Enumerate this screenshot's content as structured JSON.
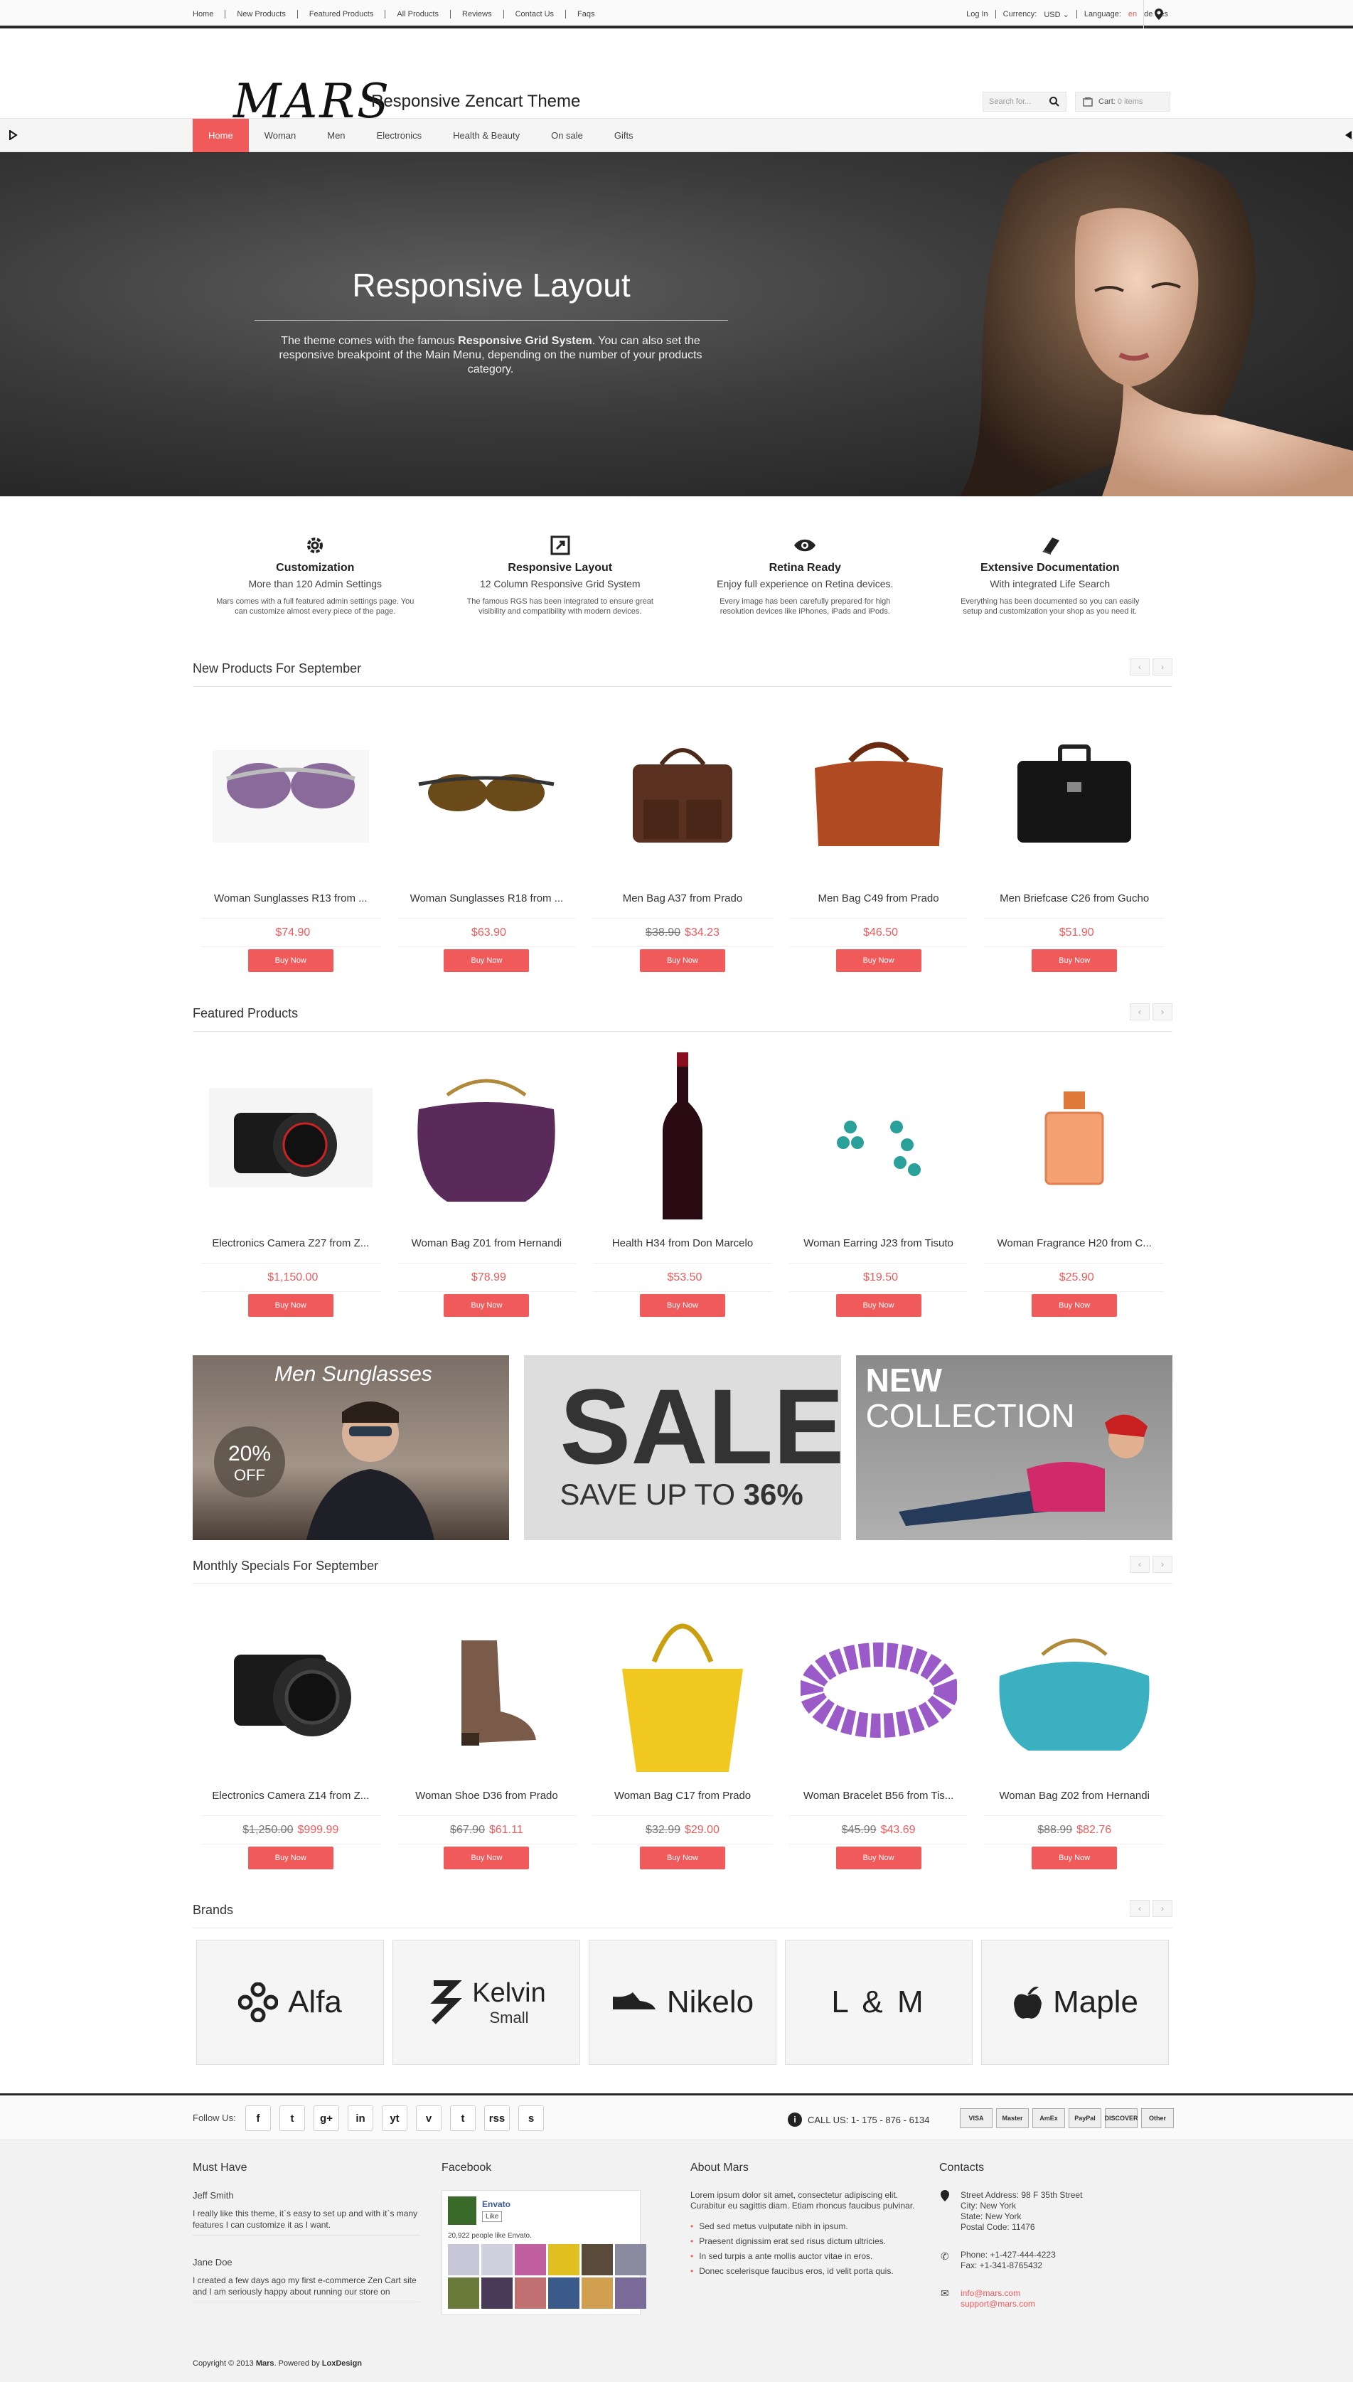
{
  "topbar": {
    "links": [
      "Home",
      "New Products",
      "Featured Products",
      "All Products",
      "Reviews",
      "Contact Us",
      "Faqs"
    ],
    "login": "Log In",
    "currency_label": "Currency:",
    "currency_value": "USD",
    "language_label": "Language:",
    "lang_en": "en",
    "lang_de": "de",
    "lang_es": "es"
  },
  "header": {
    "logo": "MARS",
    "tagline": "Responsive Zencart Theme",
    "search_placeholder": "Search for...",
    "cart_label": "Cart:",
    "cart_items": "0 items"
  },
  "nav": {
    "items": [
      "Home",
      "Woman",
      "Men",
      "Electronics",
      "Health & Beauty",
      "On sale",
      "Gifts"
    ]
  },
  "hero": {
    "title": "Responsive Layout",
    "text_before": "The theme comes with the famous ",
    "text_bold": "Responsive Grid System",
    "text_after": ". You can also set the responsive breakpoint of the Main Menu, depending on the number of your products category."
  },
  "features": [
    {
      "title": "Customization",
      "subtitle": "More than 120 Admin Settings",
      "text": "Mars comes with a full featured admin settings page. You can customize almost every piece of the page."
    },
    {
      "title": "Responsive Layout",
      "subtitle": "12 Column Responsive Grid System",
      "text": "The famous RGS has been integrated to ensure great visibility and compatibility with modern devices."
    },
    {
      "title": "Retina Ready",
      "subtitle": "Enjoy full experience on Retina devices.",
      "text": "Every image has been carefully prepared for high resolution devices like iPhones, iPads and iPods."
    },
    {
      "title": "Extensive Documentation",
      "subtitle": "With integrated Life Search",
      "text": "Everything has been documented so you can easily setup and customization your shop as you need it."
    }
  ],
  "buy_label": "Buy Now",
  "sections": {
    "new": "New Products For September",
    "featured": "Featured Products",
    "monthly": "Monthly Specials For September",
    "brands": "Brands"
  },
  "new_products": [
    {
      "name": "Woman Sunglasses R13 from ...",
      "old": "",
      "price": "$74.90"
    },
    {
      "name": "Woman Sunglasses R18 from ...",
      "old": "",
      "price": "$63.90"
    },
    {
      "name": "Men Bag A37 from Prado",
      "old": "$38.90",
      "price": "$34.23"
    },
    {
      "name": "Men Bag C49 from Prado",
      "old": "",
      "price": "$46.50"
    },
    {
      "name": "Men Briefcase C26 from Gucho",
      "old": "",
      "price": "$51.90"
    }
  ],
  "featured_products": [
    {
      "name": "Electronics Camera Z27 from Z...",
      "old": "",
      "price": "$1,150.00"
    },
    {
      "name": "Woman Bag Z01 from Hernandi",
      "old": "",
      "price": "$78.99"
    },
    {
      "name": "Health H34 from Don Marcelo",
      "old": "",
      "price": "$53.50"
    },
    {
      "name": "Woman Earring J23 from Tisuto",
      "old": "",
      "price": "$19.50"
    },
    {
      "name": "Woman Fragrance H20 from C...",
      "old": "",
      "price": "$25.90"
    }
  ],
  "monthly_products": [
    {
      "name": "Electronics Camera Z14 from Z...",
      "old": "$1,250.00",
      "price": "$999.99"
    },
    {
      "name": "Woman Shoe D36 from Prado",
      "old": "$67.90",
      "price": "$61.11"
    },
    {
      "name": "Woman Bag C17 from Prado",
      "old": "$32.99",
      "price": "$29.00"
    },
    {
      "name": "Woman Bracelet B56 from Tis...",
      "old": "$45.99",
      "price": "$43.69"
    },
    {
      "name": "Woman Bag Z02 from Hernandi",
      "old": "$88.99",
      "price": "$82.76"
    }
  ],
  "banners": {
    "men_title": "Men Sunglasses",
    "discount": "20%",
    "off": "OFF",
    "sale": "SALE",
    "save": "SAVE UP TO",
    "save_pct": "36%",
    "new": "NEW",
    "collection": "COLLECTION"
  },
  "brands": [
    {
      "name": "Alfa",
      "sub": ""
    },
    {
      "name": "Kelvin",
      "sub": "Small"
    },
    {
      "name": "Nikelo",
      "sub": ""
    },
    {
      "name": "L & M",
      "sub": ""
    },
    {
      "name": "Maple",
      "sub": ""
    }
  ],
  "follow": {
    "label": "Follow Us:",
    "icons": [
      "f",
      "t",
      "g+",
      "in",
      "yt",
      "v",
      "t",
      "rss",
      "s"
    ],
    "call": "CALL US: 1- 175 - 876 - 6134",
    "cards": [
      "VISA",
      "Master",
      "AmEx",
      "PayPal",
      "DISCOVER",
      "Other"
    ]
  },
  "footer": {
    "must_have": "Must Have",
    "reviews": [
      {
        "name": "Jeff Smith",
        "text": "I really like this theme, it`s easy to set up and with it`s many features I can customize it as I want."
      },
      {
        "name": "Jane Doe",
        "text": "I created a few days ago my first e-commerce Zen Cart site and I am seriously happy about running our store on"
      }
    ],
    "facebook": "Facebook",
    "fb_page": "Envato",
    "fb_like": "Like",
    "fb_count": "20,922 people like Envato.",
    "about": "About Mars",
    "about_text": "Lorem ipsum dolor sit amet, consectetur adipiscing elit. Curabitur eu sagittis diam. Etiam rhoncus faucibus pulvinar.",
    "about_items": [
      "Sed sed metus vulputate nibh in ipsum.",
      "Praesent dignissim erat sed risus dictum ultricies.",
      "In sed turpis a ante mollis auctor vitae in eros.",
      "Donec scelerisque faucibus eros, id velit porta quis."
    ],
    "contacts": "Contacts",
    "address": [
      "Street Address: 98 F 35th Street",
      "City: New York",
      "State: New York",
      "Postal Code: 11476"
    ],
    "phone": "Phone: +1-427-444-4223",
    "fax": "Fax: +1-341-8765432",
    "email1": "info@mars.com",
    "email2": "support@mars.com",
    "copyright_prefix": "Copyright © 2013 ",
    "copyright_brand": "Mars",
    "copyright_mid": ". Powered by ",
    "copyright_power": "LoxDesign"
  }
}
